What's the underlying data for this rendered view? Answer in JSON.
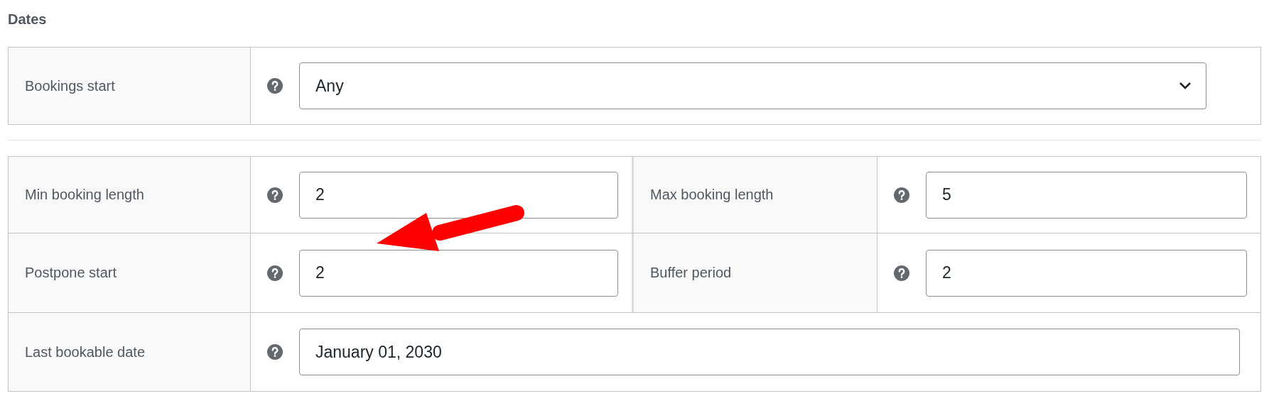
{
  "section_title": "Dates",
  "bookings_start": {
    "label": "Bookings start",
    "kind": "select",
    "value": "Any"
  },
  "field_pairs": [
    [
      {
        "label": "Min booking length",
        "kind": "input",
        "value": "2"
      },
      {
        "label": "Max booking length",
        "kind": "input",
        "value": "5"
      }
    ],
    [
      {
        "label": "Postpone start",
        "kind": "input",
        "value": "2"
      },
      {
        "label": "Buffer period",
        "kind": "input",
        "value": "2"
      }
    ]
  ],
  "last_bookable_date": {
    "label": "Last bookable date",
    "kind": "input",
    "value": "January 01, 2030"
  }
}
